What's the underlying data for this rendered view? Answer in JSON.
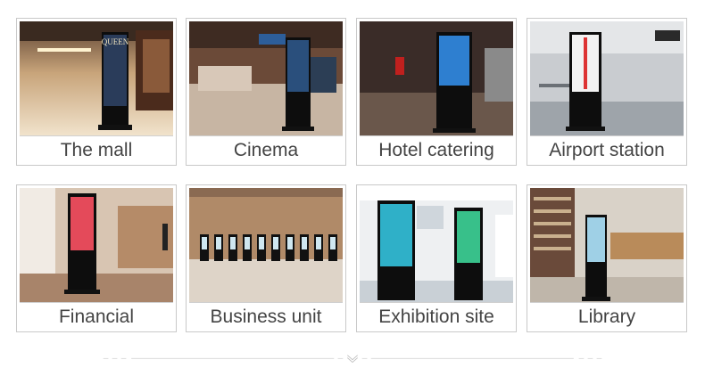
{
  "cards": [
    {
      "label": "The mall"
    },
    {
      "label": "Cinema"
    },
    {
      "label": "Hotel catering"
    },
    {
      "label": "Airport station"
    },
    {
      "label": "Financial"
    },
    {
      "label": "Business unit"
    },
    {
      "label": "Exhibition site"
    },
    {
      "label": "Library"
    }
  ],
  "photos": {
    "mall_sign": "QUEEN"
  },
  "colors": {
    "border": "#c9c9c9",
    "label_text": "#444444",
    "divider": "#cfcfcf"
  }
}
